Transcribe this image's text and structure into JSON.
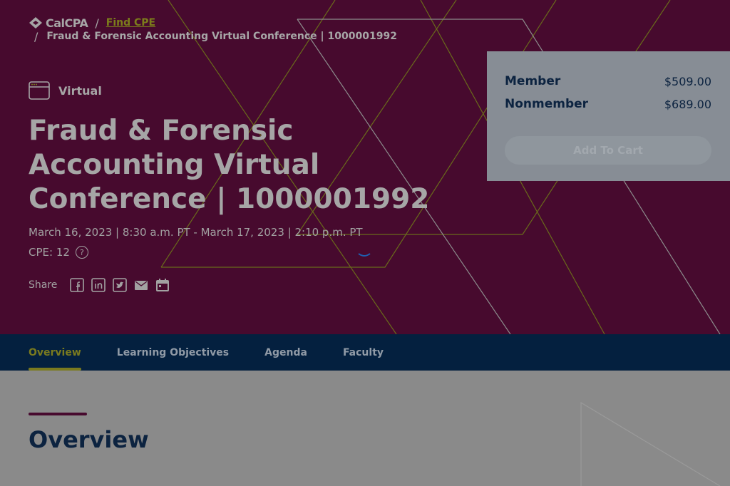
{
  "breadcrumb": {
    "logo_text": "CalCPA",
    "separator": "/",
    "find_cpe": "Find CPE",
    "current": "Fraud & Forensic Accounting Virtual Conference | 1000001992"
  },
  "event": {
    "format": "Virtual",
    "title": "Fraud & Forensic Accounting Virtual Conference | 1000001992",
    "dates": "March 16, 2023 | 8:30 a.m. PT - March 17, 2023 | 2:10 p.m. PT",
    "cpe": "CPE: 12",
    "help_glyph": "?",
    "share_label": "Share",
    "share_icons": [
      "facebook-icon",
      "linkedin-icon",
      "twitter-icon",
      "email-icon",
      "calendar-icon"
    ]
  },
  "pricing": {
    "member_label": "Member",
    "member_price": "$509.00",
    "nonmember_label": "Nonmember",
    "nonmember_price": "$689.00",
    "cart_label": "Add To Cart"
  },
  "tabs": [
    {
      "label": "Overview",
      "active": true
    },
    {
      "label": "Learning Objectives",
      "active": false
    },
    {
      "label": "Agenda",
      "active": false
    },
    {
      "label": "Faculty",
      "active": false
    }
  ],
  "overview": {
    "heading": "Overview"
  },
  "colors": {
    "hero_bg": "#470a2e",
    "navy": "#0c2340",
    "accent": "#7a7a1f",
    "overlay_gray": "#8a8a8a"
  }
}
